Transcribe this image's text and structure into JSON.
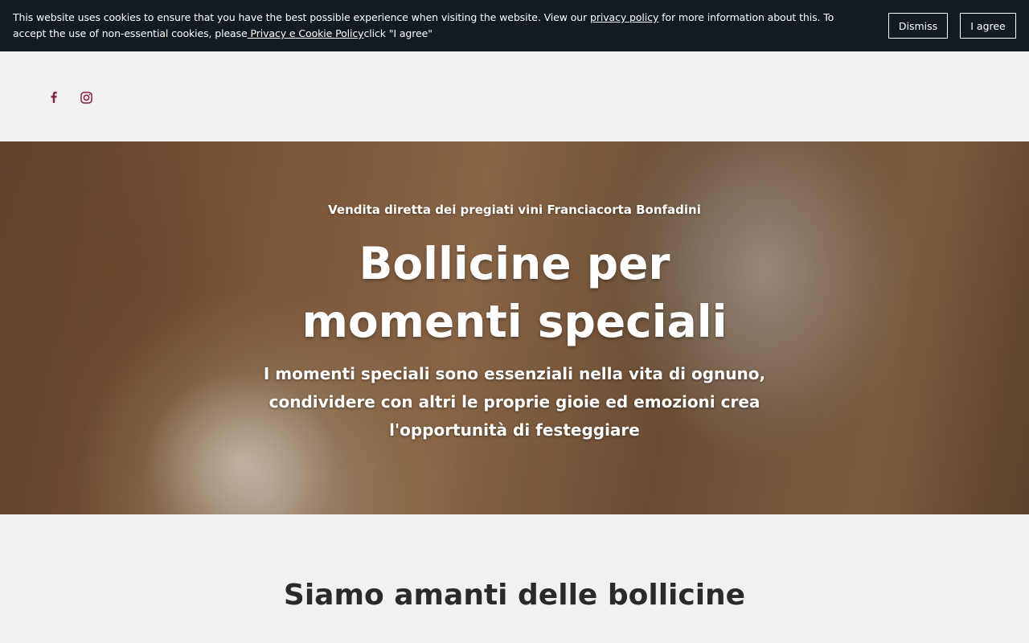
{
  "cookie_banner": {
    "text_before_link": "This website uses cookies to ensure that you have the best possible experience when visiting the website. View our ",
    "privacy_link": "privacy policy",
    "text_middle": " for more information about this. To accept the use of non-essential cookies, please",
    "cookie_policy_link": " Privacy e Cookie Policy",
    "text_after": "click \"I agree\"",
    "dismiss_label": "Dismiss",
    "agree_label": "I agree",
    "background_color": "#121a22"
  },
  "header": {
    "social_icons": [
      "facebook-icon",
      "instagram-icon"
    ],
    "icon_color": "#8b1f3f"
  },
  "hero": {
    "kicker": "Vendita diretta dei pregiati vini Franciacorta Bonfadini",
    "title": "Bollicine per momenti speciali",
    "description": "I momenti speciali sono essenziali nella vita di ognuno, condividere con altri le proprie gioie ed emozioni crea l'opportunità di festeggiare"
  },
  "section": {
    "title": "Siamo amanti delle bollicine"
  }
}
